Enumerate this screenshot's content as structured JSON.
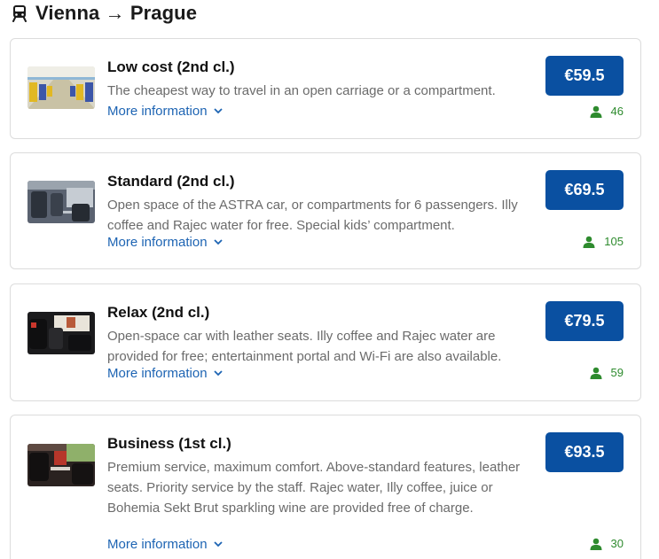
{
  "route": {
    "icon": "train-icon",
    "title": "Vienna → Prague"
  },
  "colors": {
    "accent": "#0a50a1",
    "link": "#1d64b3",
    "seats": "#2e8b2e"
  },
  "fares": [
    {
      "name": "Low cost (2nd cl.)",
      "description": "The cheapest way to travel in an open carriage or a compartment.",
      "more_label": "More information",
      "price": "€59.5",
      "seats": "46"
    },
    {
      "name": "Standard (2nd cl.)",
      "description": "Open space of the ASTRA car, or compartments for 6 passengers. Illy coffee and Rajec water for free. Special kids’ compartment.",
      "more_label": "More information",
      "price": "€69.5",
      "seats": "105"
    },
    {
      "name": "Relax (2nd cl.)",
      "description": "Open-space car with leather seats. Illy coffee and Rajec water are provided for free; entertainment portal and Wi-Fi are also available.",
      "more_label": "More information",
      "price": "€79.5",
      "seats": "59"
    },
    {
      "name": "Business (1st cl.)",
      "description": "Premium service, maximum comfort. Above-standard features, leather seats. Priority service by the staff. Rajec water, Illy coffee, juice or Bohemia Sekt Brut sparkling wine are provided free of charge.",
      "more_label": "More information",
      "price": "€93.5",
      "seats": "30"
    }
  ]
}
